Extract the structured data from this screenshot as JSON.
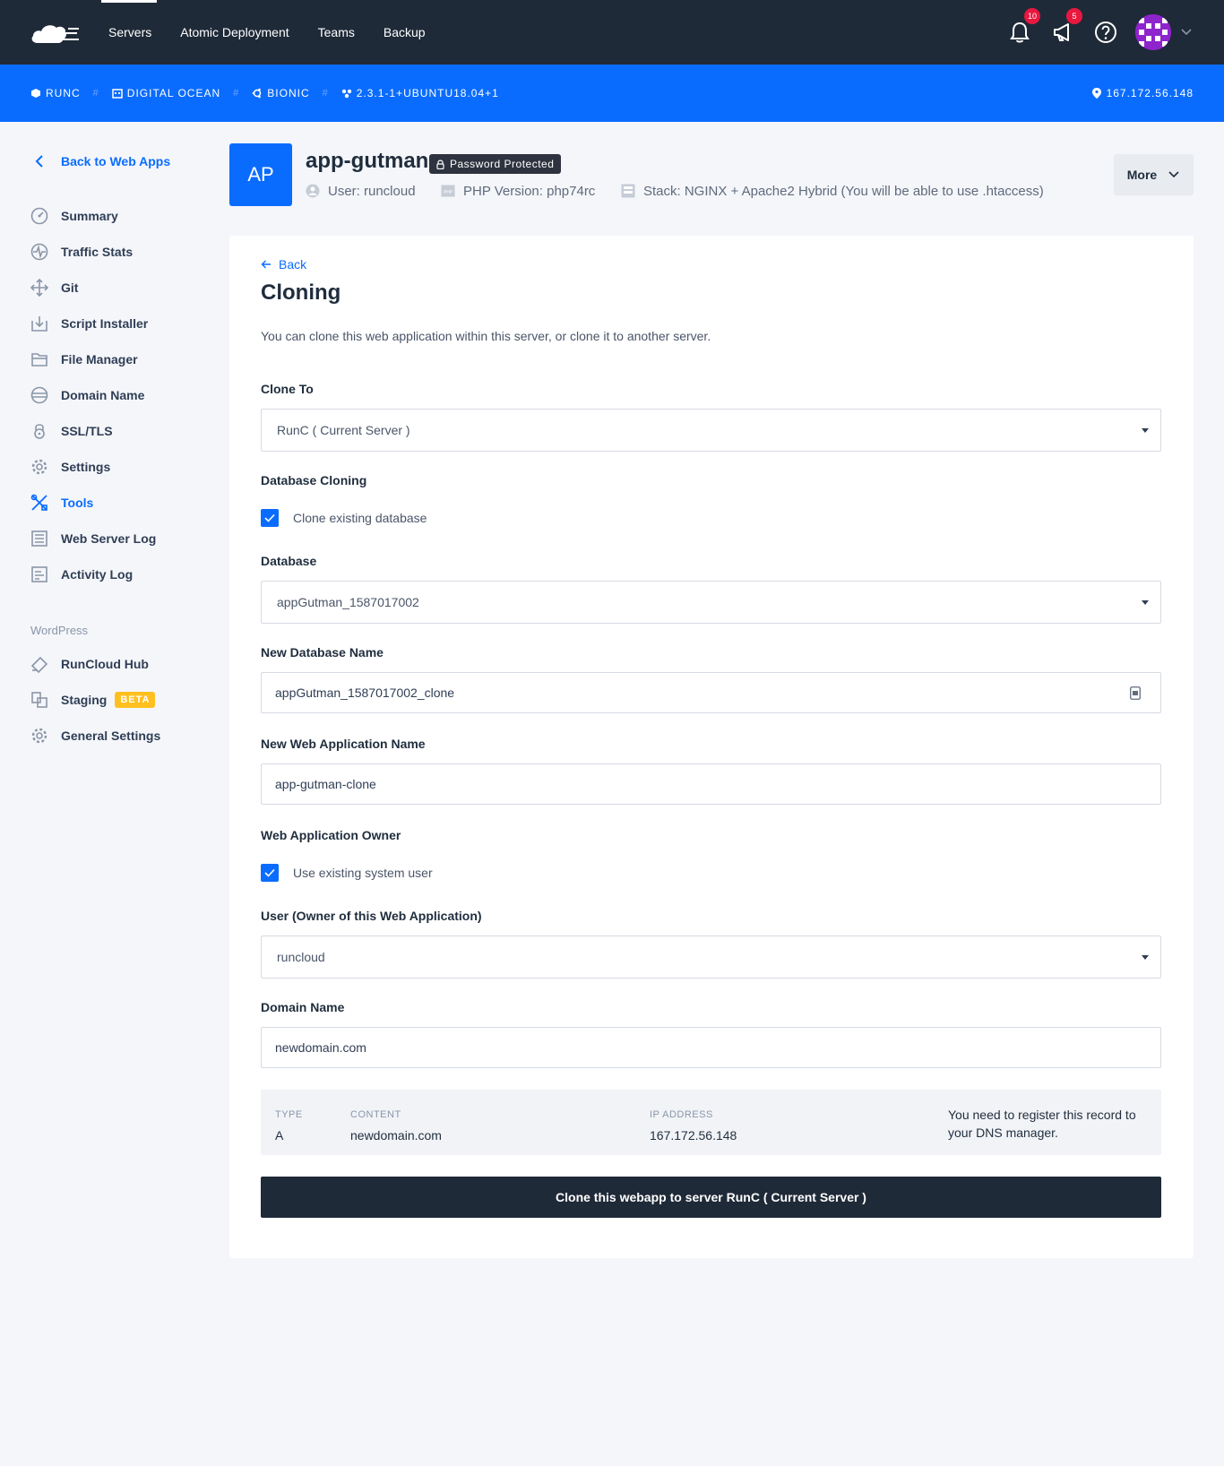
{
  "topnav": {
    "logo": "runcloud-cloud-logo",
    "links": [
      "Servers",
      "Atomic Deployment",
      "Teams",
      "Backup"
    ],
    "notifications_count": "10",
    "announcements_count": "5"
  },
  "bluebar": {
    "server": "RUNC",
    "provider": "DIGITAL OCEAN",
    "os": "BIONIC",
    "agent_version": "2.3.1-1+UBUNTU18.04+1",
    "ip": "167.172.56.148"
  },
  "sidebar": {
    "back_label": "Back to Web Apps",
    "items": [
      {
        "label": "Summary",
        "icon": "gauge-icon"
      },
      {
        "label": "Traffic Stats",
        "icon": "activity-icon"
      },
      {
        "label": "Git",
        "icon": "git-icon"
      },
      {
        "label": "Script Installer",
        "icon": "download-icon"
      },
      {
        "label": "File Manager",
        "icon": "folder-icon"
      },
      {
        "label": "Domain Name",
        "icon": "globe-icon"
      },
      {
        "label": "SSL/TLS",
        "icon": "lock-icon"
      },
      {
        "label": "Settings",
        "icon": "gear-icon"
      },
      {
        "label": "Tools",
        "icon": "tools-icon"
      },
      {
        "label": "Web Server Log",
        "icon": "log-icon"
      },
      {
        "label": "Activity Log",
        "icon": "activity-log-icon"
      }
    ],
    "active": "Tools",
    "section_title": "WordPress",
    "wp_items": [
      {
        "label": "RunCloud Hub",
        "icon": "hub-icon"
      },
      {
        "label": "Staging",
        "icon": "staging-icon",
        "badge": "BETA"
      },
      {
        "label": "General Settings",
        "icon": "gear-icon"
      }
    ]
  },
  "app": {
    "initials": "AP",
    "name": "app-gutman",
    "protected_badge": "Password Protected",
    "user": "User: runcloud",
    "php": "PHP Version: php74rc",
    "stack": "Stack: NGINX + Apache2 Hybrid (You will be able to use .htaccess)",
    "more_label": "More"
  },
  "form": {
    "back_label": "Back",
    "title": "Cloning",
    "description": "You can clone this web application within this server, or clone it to another server.",
    "clone_to_label": "Clone To",
    "clone_to_value": "RunC ( Current Server )",
    "db_cloning_label": "Database Cloning",
    "clone_db_checkbox": "Clone existing database",
    "database_label": "Database",
    "database_value": "appGutman_1587017002",
    "new_db_label": "New Database Name",
    "new_db_value": "appGutman_1587017002_clone",
    "new_app_label": "New Web Application Name",
    "new_app_value": "app-gutman-clone",
    "owner_label": "Web Application Owner",
    "owner_checkbox": "Use existing system user",
    "user_label": "User (Owner of this Web Application)",
    "user_value": "runcloud",
    "domain_label": "Domain Name",
    "domain_value": "newdomain.com",
    "dns": {
      "type_h": "TYPE",
      "type_v": "A",
      "content_h": "CONTENT",
      "content_v": "newdomain.com",
      "ip_h": "IP ADDRESS",
      "ip_v": "167.172.56.148",
      "note": "You need to register this record to your DNS manager."
    },
    "submit_label": "Clone this webapp to server RunC ( Current Server )"
  },
  "colors": {
    "nav_bg": "#1f2a38",
    "accent": "#0a6cff",
    "badge_red": "#e8183f",
    "beta_yellow": "#ffc01f"
  }
}
